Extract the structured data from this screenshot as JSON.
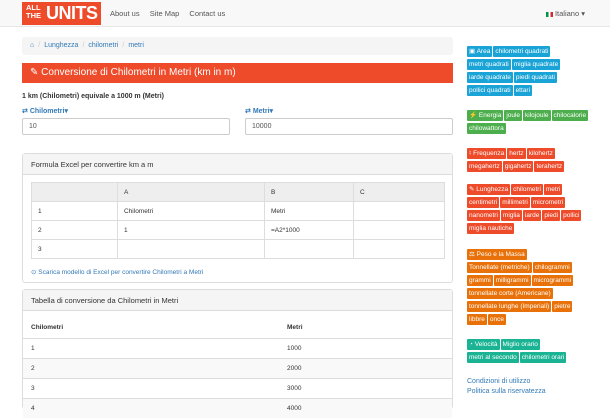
{
  "nav": {
    "logo_top": "ALL",
    "logo_mid": "THE",
    "logo_units": "UNITS",
    "links": [
      "About us",
      "Site Map",
      "Contact us"
    ],
    "language": "Italiano"
  },
  "breadcrumb": [
    "Lunghezza",
    "chilometri",
    "metri"
  ],
  "title": "Conversione di Chilometri in Metri (km in m)",
  "equation": "1 km (Chilometri) equivale a 1000 m (Metri)",
  "from": {
    "label": "Chilometri",
    "value": "10"
  },
  "to": {
    "label": "Metri",
    "value": "10000"
  },
  "excel": {
    "heading": "Formula Excel per convertire km a m",
    "headers": [
      "",
      "A",
      "B",
      "C"
    ],
    "rows": [
      [
        "1",
        "Chilometri",
        "Metri",
        ""
      ],
      [
        "2",
        "1",
        "=A2*1000",
        ""
      ],
      [
        "3",
        "",
        "",
        ""
      ]
    ],
    "download": "Scarica modello di Excel per convertire Chilometri a Metri"
  },
  "table": {
    "heading": "Tabella di conversione da Chilometri in Metri",
    "headers": [
      "Chilometri",
      "Metri"
    ],
    "rows": [
      [
        "1",
        "1000"
      ],
      [
        "2",
        "2000"
      ],
      [
        "3",
        "3000"
      ],
      [
        "4",
        "4000"
      ]
    ]
  },
  "sidebar": [
    {
      "color": "b",
      "items": [
        "Area",
        "chilometri quadrati",
        "metri quadrati",
        "miglia quadrate",
        "iarde quadrate",
        "piedi quadrati",
        "pollici quadrati",
        "ettari"
      ]
    },
    {
      "color": "g",
      "items": [
        "Energia",
        "joule",
        "kilojoule",
        "chilocalorie",
        "chilowattora"
      ]
    },
    {
      "color": "r",
      "items": [
        "Frequenza",
        "hertz",
        "kilohertz",
        "megahertz",
        "gigahertz",
        "terahertz"
      ]
    },
    {
      "color": "r",
      "items": [
        "Lunghezza",
        "chilometri",
        "metri",
        "centimetri",
        "millimetri",
        "micrometri",
        "nanometri",
        "miglia",
        "iarde",
        "piedi",
        "pollici",
        "miglia nautiche"
      ]
    },
    {
      "color": "o",
      "items": [
        "Peso e la Massa",
        "Tonnellate (metriche)",
        "chilogrammi",
        "grammi",
        "milligrammi",
        "microgrammi",
        "tonnellate corte (Americane)",
        "tonnellate lunghe (Imperiali)",
        "pietre",
        "libbre",
        "once"
      ]
    },
    {
      "color": "t",
      "items": [
        "Velocità",
        "Miglio orario",
        "metri al secondo",
        "chilometri orari"
      ]
    }
  ],
  "footer": [
    "Condizioni di utilizzo",
    "Politica sulla riservatezza"
  ]
}
